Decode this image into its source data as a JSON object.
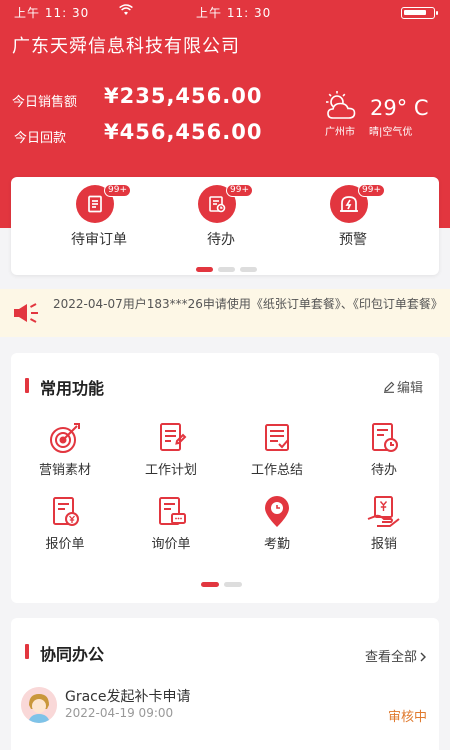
{
  "status_bar": {
    "time_left": "上午 11: 30",
    "time_right": "上午 11: 30"
  },
  "header": {
    "company": "广东天舜信息科技有限公司",
    "sales_label": "今日销售额",
    "sales_value": "¥235,456.00",
    "receipt_label": "今日回款",
    "receipt_value": "¥456,456.00"
  },
  "weather": {
    "temp": "29° C",
    "city": "广州市",
    "condition": "晴|空气优",
    "icon": "partly-cloudy-icon"
  },
  "quick_actions": [
    {
      "label": "待审订单",
      "badge": "99+",
      "icon": "pending-order-icon"
    },
    {
      "label": "待办",
      "badge": "99+",
      "icon": "todo-icon"
    },
    {
      "label": "预警",
      "badge": "99+",
      "icon": "alert-icon"
    }
  ],
  "notice": {
    "text": "2022-04-07用户183***26申请使用《纸张订单套餐》、《印包订单套餐》"
  },
  "functions": {
    "title": "常用功能",
    "edit_label": "编辑",
    "items": [
      {
        "label": "营销素材",
        "icon": "target-icon"
      },
      {
        "label": "工作计划",
        "icon": "plan-icon"
      },
      {
        "label": "工作总结",
        "icon": "summary-icon"
      },
      {
        "label": "待办",
        "icon": "todo-icon"
      },
      {
        "label": "报价单",
        "icon": "quote-icon"
      },
      {
        "label": "询价单",
        "icon": "inquiry-icon"
      },
      {
        "label": "考勤",
        "icon": "attendance-icon"
      },
      {
        "label": "报销",
        "icon": "reimburse-icon"
      }
    ]
  },
  "collab": {
    "title": "协同办公",
    "view_all": "查看全部",
    "items": [
      {
        "title": "Grace发起补卡申请",
        "time": "2022-04-19 09:00",
        "status": "审核中"
      }
    ]
  },
  "colors": {
    "brand": "#e2363f",
    "status_pending": "#e07a2e"
  }
}
